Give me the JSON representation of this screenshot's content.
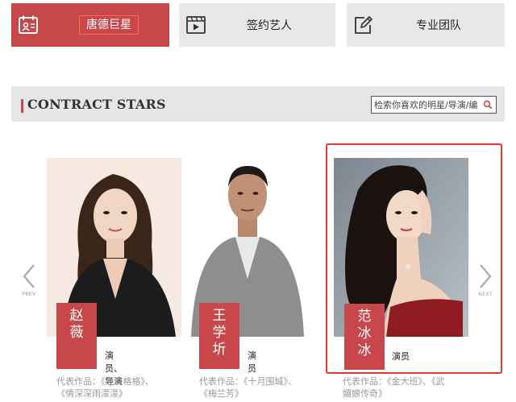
{
  "tabs": [
    {
      "label": "唐德巨星",
      "icon": "calendar-person-icon",
      "active": true
    },
    {
      "label": "签约艺人",
      "icon": "video-play-icon",
      "active": false
    },
    {
      "label": "专业团队",
      "icon": "edit-note-icon",
      "active": false
    }
  ],
  "section": {
    "title": "CONTRACT STARS",
    "search_placeholder": "检索你喜欢的明星/导演/编剧"
  },
  "carousel": {
    "prev_label": "PREV",
    "next_label": "NEXT"
  },
  "stars": [
    {
      "name_chars": [
        "赵",
        "薇"
      ],
      "role": "演员、导演",
      "works_line1": "代表作品：《还珠格格》、",
      "works_line2": "《情深深雨濛濛》"
    },
    {
      "name_chars": [
        "王",
        "学",
        "圻"
      ],
      "role": "演员",
      "works_line1": "代表作品：《十月围城》、",
      "works_line2": "《梅兰芳》"
    },
    {
      "name_chars": [
        "范",
        "冰",
        "冰"
      ],
      "role": "演员",
      "works_line1": "代表作品：《金大班》、《武",
      "works_line2": "媚娘传奇》",
      "selected": true
    }
  ],
  "colors": {
    "accent": "#c8474b",
    "tab_bg": "#e8e8e8",
    "header_bg": "#e6e6e6",
    "highlight_border": "#e23a2e"
  }
}
